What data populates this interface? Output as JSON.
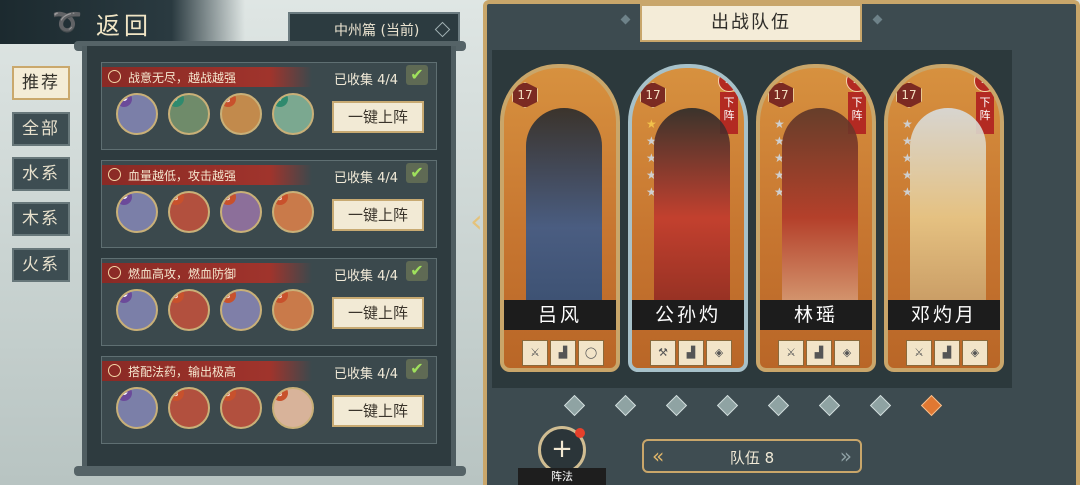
{
  "header": {
    "back_label": "返回",
    "chapter": "中州篇 (当前)"
  },
  "tabs": [
    {
      "label": "推荐",
      "active": true
    },
    {
      "label": "全部",
      "active": false
    },
    {
      "label": "水系",
      "active": false
    },
    {
      "label": "木系",
      "active": false
    },
    {
      "label": "火系",
      "active": false
    }
  ],
  "recommend": [
    {
      "desc": "战意无尽，越战越强",
      "collected": "已收集 4/4",
      "button": "一键上阵"
    },
    {
      "desc": "血量越低，攻击越强",
      "collected": "已收集 4/4",
      "button": "一键上阵"
    },
    {
      "desc": "燃血高攻，燃血防御",
      "collected": "已收集 4/4",
      "button": "一键上阵"
    },
    {
      "desc": "搭配法药，输出极高",
      "collected": "已收集 4/4",
      "button": "一键上阵"
    }
  ],
  "team": {
    "title": "出战队伍",
    "heroes": [
      {
        "name": "吕风",
        "level": "17",
        "stars": 0,
        "remove": false
      },
      {
        "name": "公孙灼",
        "level": "17",
        "stars": 1,
        "remove": true,
        "remove_label": "下阵"
      },
      {
        "name": "林瑶",
        "level": "17",
        "stars": 0,
        "remove": true,
        "remove_label": "下阵"
      },
      {
        "name": "邓灼月",
        "level": "17",
        "stars": 0,
        "remove": true,
        "remove_label": "下阵"
      }
    ],
    "team_label": "队伍 8",
    "formation_label": "阵法",
    "page_count": 8,
    "page_active": 8
  },
  "colors": {
    "accent": "#c9a66a",
    "ribbon": "#a0342c",
    "active_dot": "#e07832"
  }
}
